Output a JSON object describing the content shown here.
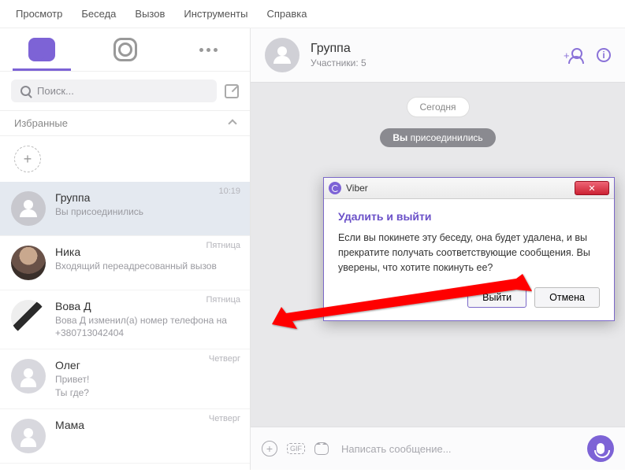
{
  "menu": {
    "view": "Просмотр",
    "chat": "Беседа",
    "call": "Вызов",
    "tools": "Инструменты",
    "help": "Справка"
  },
  "search": {
    "placeholder": "Поиск..."
  },
  "favorites": {
    "label": "Избранные"
  },
  "chats": [
    {
      "name": "Группа",
      "sub": "Вы присоединились",
      "time": "10:19"
    },
    {
      "name": "Ника",
      "sub": "Входящий переадресованный вызов",
      "time": "Пятница"
    },
    {
      "name": "Вова Д",
      "sub": "Вова Д изменил(а) номер телефона на +380713042404",
      "time": "Пятница"
    },
    {
      "name": "Олег",
      "sub": "Привет!\nТы где?",
      "time": "Четверг"
    },
    {
      "name": "Мама",
      "sub": "",
      "time": "Четверг"
    }
  ],
  "header": {
    "title": "Группа",
    "subtitle": "Участники: 5"
  },
  "timeline": {
    "date": "Сегодня",
    "joined_prefix": "Вы",
    "joined_rest": " присоединились"
  },
  "composer": {
    "placeholder": "Написать сообщение..."
  },
  "dialog": {
    "app": "Viber",
    "heading": "Удалить и выйти",
    "body": "Если вы покинете эту беседу, она будет удалена, и вы прекратите получать соответствующие сообщения. Вы уверены, что хотите покинуть ее?",
    "ok": "Выйти",
    "cancel": "Отмена"
  }
}
